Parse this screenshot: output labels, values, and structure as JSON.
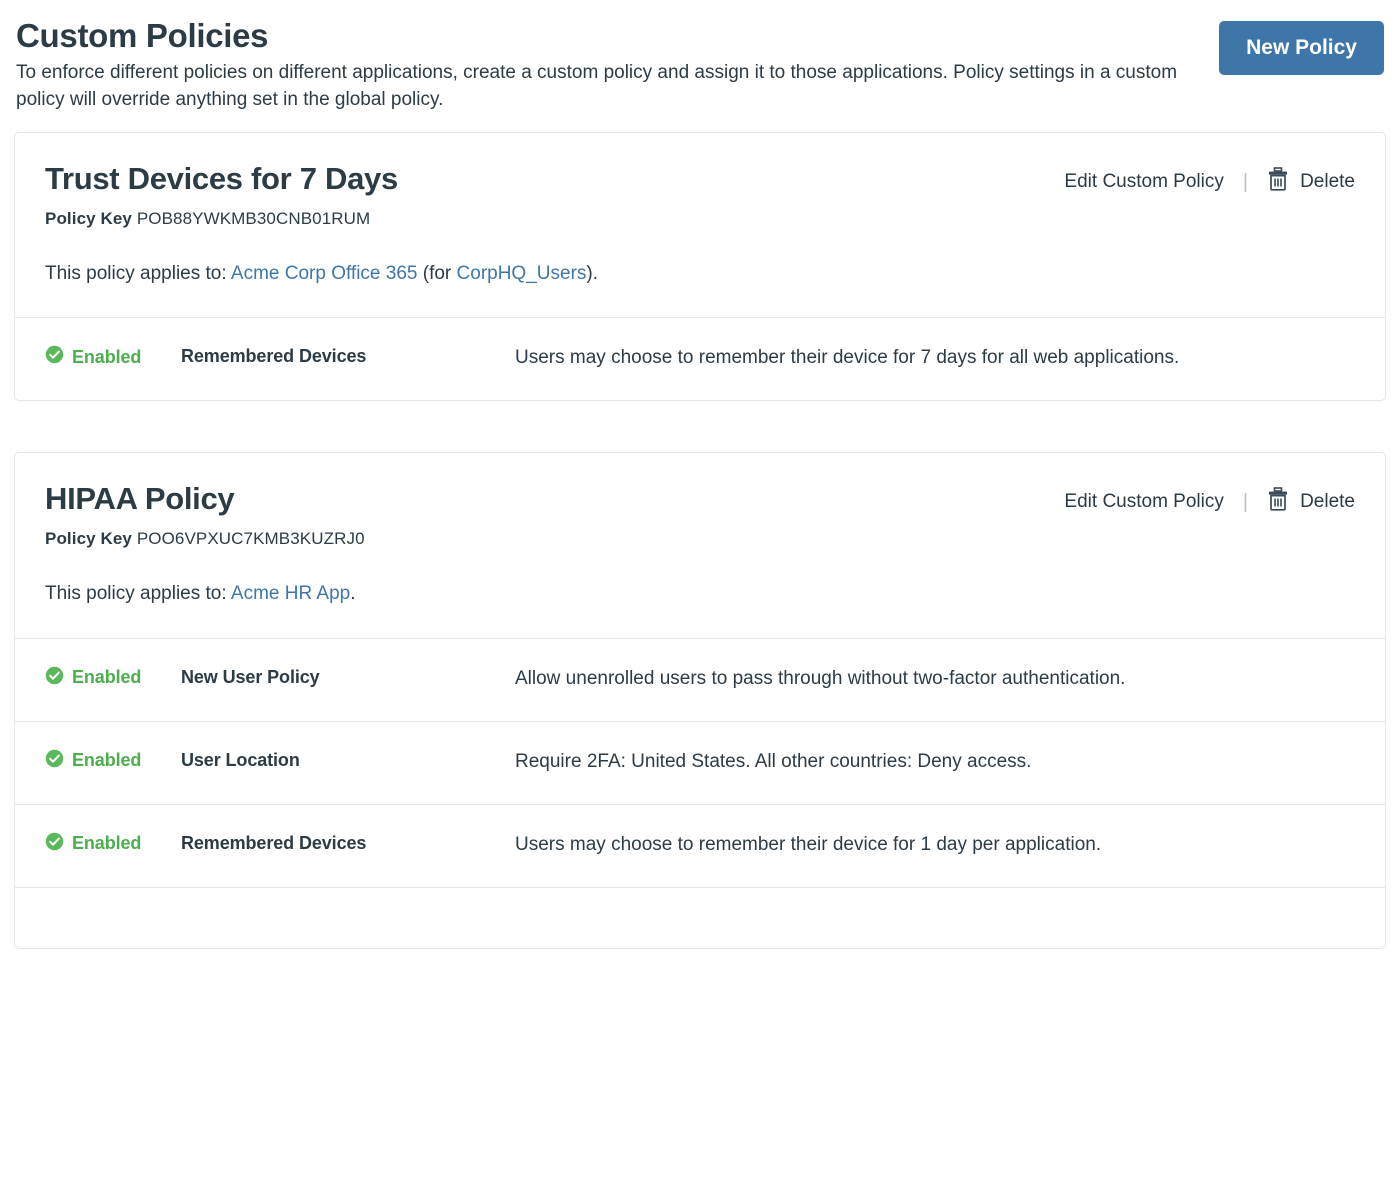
{
  "header": {
    "title": "Custom Policies",
    "description": "To enforce different policies on different applications, create a custom policy and assign it to those applications. Policy settings in a custom policy will override anything set in the global policy.",
    "new_policy_label": "New Policy",
    "new_policy_color": "#3f76aa"
  },
  "common": {
    "edit_label": "Edit Custom Policy",
    "delete_label": "Delete",
    "separator": "|",
    "policy_key_label": "Policy Key",
    "applies_prefix": "This policy applies to:",
    "enabled_label": "Enabled",
    "enabled_color": "#4cae4c",
    "link_color": "#3f76aa",
    "trash_icon": "trash-icon",
    "check_icon": "check-circle-icon"
  },
  "policies": [
    {
      "name": "Trust Devices for 7 Days",
      "policy_key": "POB88YWKMB30CNB01RUM",
      "applies_prefix": "This policy applies to:",
      "application": "Acme Corp Office 365",
      "group_prefix": "(for",
      "group": "CorpHQ_Users",
      "group_suffix": ").",
      "settings": [
        {
          "status": "Enabled",
          "name": "Remembered Devices",
          "description": "Users may choose to remember their device for 7 days for all web applications."
        }
      ]
    },
    {
      "name": "HIPAA Policy",
      "policy_key": "POO6VPXUC7KMB3KUZRJ0",
      "applies_prefix": "This policy applies to:",
      "application": "Acme HR App",
      "group_prefix": "",
      "group": "",
      "group_suffix": ".",
      "settings": [
        {
          "status": "Enabled",
          "name": "New User Policy",
          "description": "Allow unenrolled users to pass through without two-factor authentication."
        },
        {
          "status": "Enabled",
          "name": "User Location",
          "description": "Require 2FA: United States. All other countries: Deny access."
        },
        {
          "status": "Enabled",
          "name": "Remembered Devices",
          "description": "Users may choose to remember their device for 1 day per application."
        },
        {
          "status": "",
          "name": "",
          "description": ""
        }
      ]
    }
  ]
}
